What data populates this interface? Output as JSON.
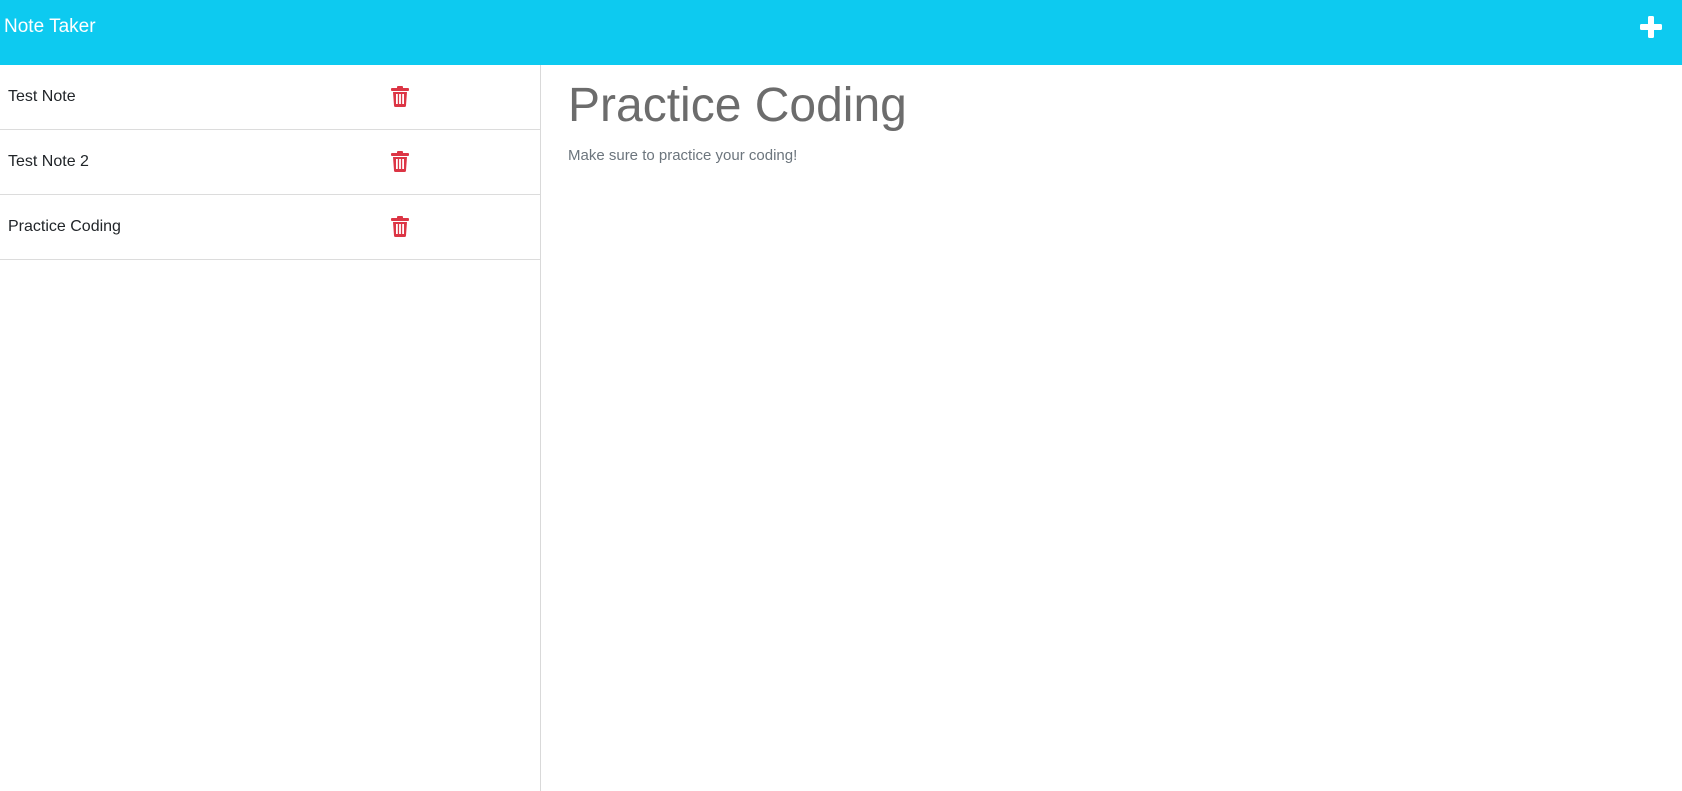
{
  "app": {
    "brand": "Note Taker"
  },
  "header": {
    "new_note_icon": "plus-icon",
    "accent_color": "#0dcaf0",
    "text_color": "#ffffff"
  },
  "sidebar": {
    "items": [
      {
        "title": "Test Note",
        "delete_icon": "trash-icon"
      },
      {
        "title": "Test Note 2",
        "delete_icon": "trash-icon"
      },
      {
        "title": "Practice Coding",
        "delete_icon": "trash-icon"
      }
    ],
    "delete_color": "#dc3545"
  },
  "editor": {
    "title": "Practice Coding",
    "body": "Make sure to practice your coding!"
  }
}
